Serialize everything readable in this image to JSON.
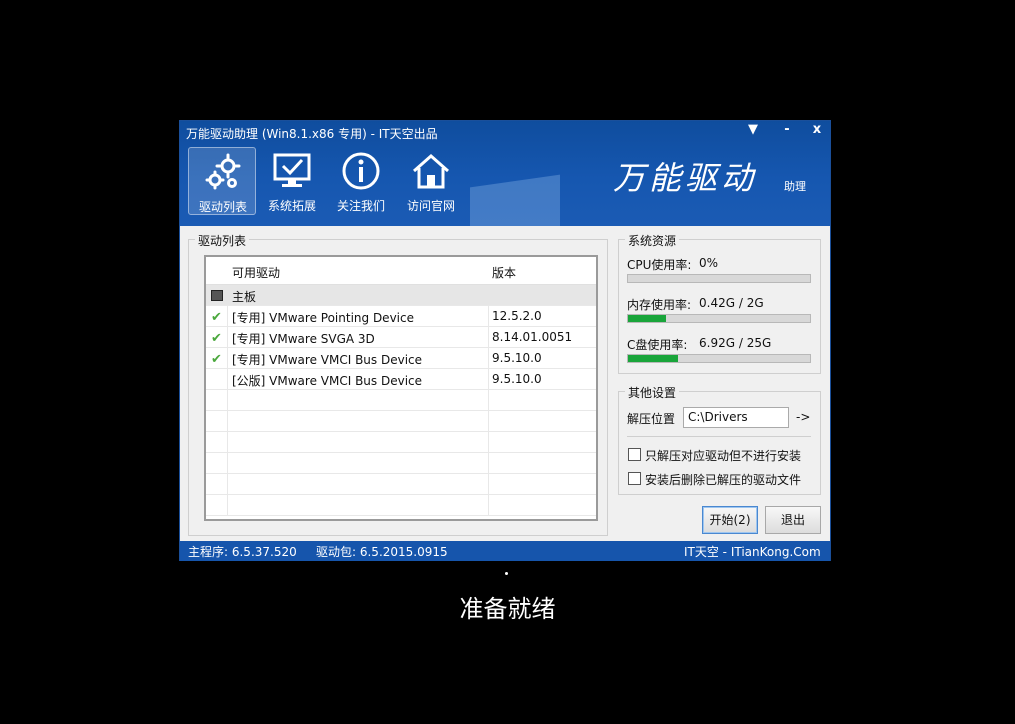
{
  "window": {
    "title": "万能驱动助理 (Win8.1.x86 专用) - IT天空出品",
    "controls": {
      "menu": "▼",
      "minimize": "-",
      "close": "x"
    }
  },
  "nav": [
    {
      "label": "驱动列表",
      "icon": "gears-icon"
    },
    {
      "label": "系统拓展",
      "icon": "monitor-check-icon"
    },
    {
      "label": "关注我们",
      "icon": "info-icon"
    },
    {
      "label": "访问官网",
      "icon": "home-icon"
    }
  ],
  "brand": {
    "text": "万能驱动",
    "sub": "助理"
  },
  "driver_list": {
    "legend": "驱动列表",
    "columns": [
      "可用驱动",
      "版本"
    ],
    "group": "主板",
    "rows": [
      {
        "name": "[专用] VMware Pointing Device",
        "version": "12.5.2.0",
        "checked": true
      },
      {
        "name": "[专用] VMware SVGA 3D",
        "version": "8.14.01.0051",
        "checked": true
      },
      {
        "name": "[专用] VMware VMCI Bus Device",
        "version": "9.5.10.0",
        "checked": true
      },
      {
        "name": "[公版] VMware VMCI Bus Device",
        "version": "9.5.10.0",
        "checked": false
      }
    ]
  },
  "resources": {
    "legend": "系统资源",
    "cpu": {
      "label": "CPU使用率:",
      "value": "0%",
      "fraction": 0.0
    },
    "memory": {
      "label": "内存使用率:",
      "value": "0.42G / 2G",
      "fraction": 0.21
    },
    "disk": {
      "label": "C盘使用率:",
      "value": "6.92G / 25G",
      "fraction": 0.277
    }
  },
  "settings": {
    "legend": "其他设置",
    "extract_label": "解压位置",
    "extract_path": "C:\\Drivers",
    "browse": "->",
    "opt1": "只解压对应驱动但不进行安装",
    "opt2": "安装后删除已解压的驱动文件"
  },
  "buttons": {
    "start": "开始(2)",
    "exit": "退出"
  },
  "status": {
    "main": "主程序: 6.5.37.520",
    "pack": "驱动包: 6.5.2015.0915",
    "site": "IT天空 - ITianKong.Com"
  },
  "footer": {
    "ready": "准备就绪"
  },
  "colors": {
    "header": "#1657b0",
    "progress": "#19a53a",
    "check": "#4aa83c"
  }
}
